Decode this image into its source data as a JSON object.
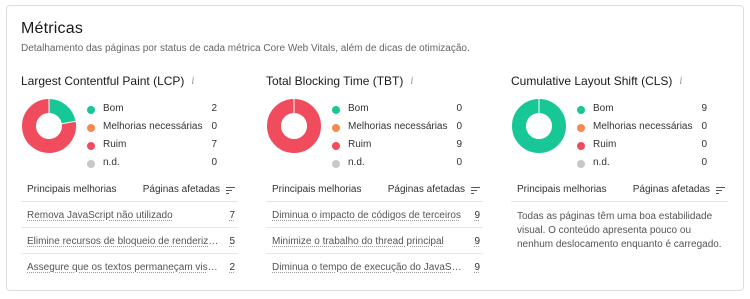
{
  "header": {
    "title": "Métricas",
    "description": "Detalhamento das páginas por status de cada métrica Core Web Vitals, além de dicas de otimização."
  },
  "colors": {
    "good": "#17c795",
    "needs_improvement": "#f58a4e",
    "poor": "#f04c5e",
    "na": "#c8c8c8"
  },
  "legend_labels": [
    "Bom",
    "Melhorias necessárias",
    "Ruim",
    "n.d."
  ],
  "table_headers": {
    "improvements": "Principais melhorias",
    "affected_pages": "Páginas afetadas"
  },
  "metrics": [
    {
      "title": "Largest Contentful Paint (LCP)",
      "counts": [
        "2",
        "0",
        "7",
        "0"
      ],
      "improvements": [
        {
          "label": "Remova JavaScript não utilizado",
          "count": "7"
        },
        {
          "label": "Elimine recursos de bloqueio de renderização",
          "count": "5"
        },
        {
          "label": "Assegure que os textos permaneçam visíveis",
          "count": "2"
        }
      ]
    },
    {
      "title": "Total Blocking Time (TBT)",
      "counts": [
        "0",
        "0",
        "9",
        "0"
      ],
      "improvements": [
        {
          "label": "Diminua o impacto de códigos de terceiros",
          "count": "9"
        },
        {
          "label": "Minimize o trabalho do thread principal",
          "count": "9"
        },
        {
          "label": "Diminua o tempo de execução do JavaScript",
          "count": "9"
        }
      ]
    },
    {
      "title": "Cumulative Layout Shift (CLS)",
      "counts": [
        "9",
        "0",
        "0",
        "0"
      ],
      "note": "Todas as páginas têm uma boa estabilidade visual. O conteúdo apresenta pouco ou nenhum deslocamento enquanto é carregado."
    }
  ]
}
